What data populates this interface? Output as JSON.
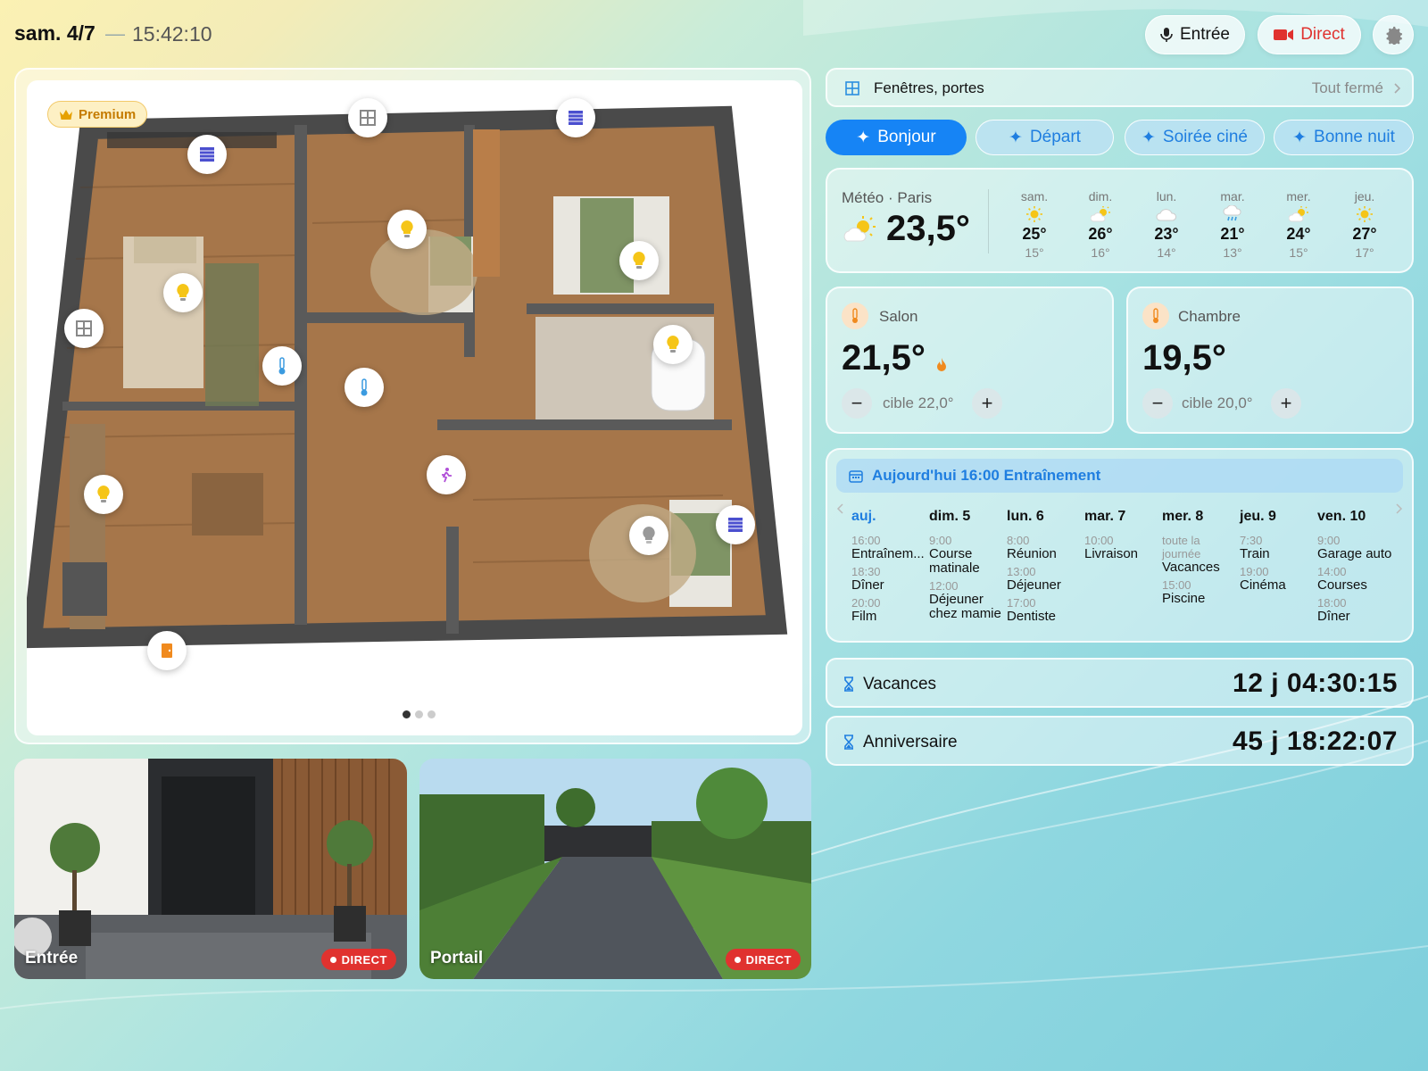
{
  "topbar": {
    "date": "sam. 4/7",
    "separator": "—",
    "time": "15:42:10",
    "entree_button": "Entrée",
    "direct_button": "Direct"
  },
  "plan": {
    "premium_badge": "Premium",
    "page_count": 3,
    "active_page": 1
  },
  "cameras": [
    {
      "label": "Entrée",
      "badge": "DIRECT"
    },
    {
      "label": "Portail",
      "badge": "DIRECT"
    }
  ],
  "windows_card": {
    "label": "Fenêtres, portes",
    "status": "Tout fermé"
  },
  "scenes": [
    {
      "label": "Bonjour",
      "active": true
    },
    {
      "label": "Départ",
      "active": false
    },
    {
      "label": "Soirée ciné",
      "active": false
    },
    {
      "label": "Bonne nuit",
      "active": false
    }
  ],
  "weather": {
    "title": "Météo · Paris",
    "current_temp": "23,5°",
    "forecast": [
      {
        "day": "sam.",
        "icon": "sun-icon",
        "high": "25°",
        "low": "15°"
      },
      {
        "day": "dim.",
        "icon": "partly-sunny-icon",
        "high": "26°",
        "low": "16°"
      },
      {
        "day": "lun.",
        "icon": "cloud-icon",
        "high": "23°",
        "low": "14°"
      },
      {
        "day": "mar.",
        "icon": "rain-icon",
        "high": "21°",
        "low": "13°"
      },
      {
        "day": "mer.",
        "icon": "partly-sunny-icon",
        "high": "24°",
        "low": "15°"
      },
      {
        "day": "jeu.",
        "icon": "sun-icon",
        "high": "27°",
        "low": "17°"
      }
    ]
  },
  "thermostats": [
    {
      "room": "Salon",
      "temp": "21,5°",
      "target": "cible 22,0°",
      "heating": true
    },
    {
      "room": "Chambre",
      "temp": "19,5°",
      "target": "cible 20,0°",
      "heating": false
    }
  ],
  "calendar": {
    "header": "Aujourd'hui 16:00 Entraînement",
    "days": [
      {
        "label": "auj.",
        "events": [
          {
            "time": "16:00",
            "name": "Entraînem..."
          },
          {
            "time": "18:30",
            "name": "Dîner"
          },
          {
            "time": "20:00",
            "name": "Film"
          }
        ]
      },
      {
        "label": "dim. 5",
        "events": [
          {
            "time": "9:00",
            "name": "Course matinale"
          },
          {
            "time": "12:00",
            "name": "Déjeuner chez mamie"
          }
        ]
      },
      {
        "label": "lun. 6",
        "events": [
          {
            "time": "8:00",
            "name": "Réunion"
          },
          {
            "time": "13:00",
            "name": "Déjeuner"
          },
          {
            "time": "17:00",
            "name": "Dentiste"
          }
        ]
      },
      {
        "label": "mar. 7",
        "events": [
          {
            "time": "10:00",
            "name": "Livraison"
          }
        ]
      },
      {
        "label": "mer. 8",
        "events": [
          {
            "time": "toute la journée",
            "name": "Vacances"
          },
          {
            "time": "15:00",
            "name": "Piscine"
          }
        ]
      },
      {
        "label": "jeu. 9",
        "events": [
          {
            "time": "7:30",
            "name": "Train"
          },
          {
            "time": "19:00",
            "name": "Cinéma"
          }
        ]
      },
      {
        "label": "ven. 10",
        "events": [
          {
            "time": "9:00",
            "name": "Garage auto"
          },
          {
            "time": "14:00",
            "name": "Courses"
          },
          {
            "time": "18:00",
            "name": "Dîner"
          }
        ]
      }
    ]
  },
  "countdowns": [
    {
      "label": "Vacances",
      "value": "12 j 04:30:15"
    },
    {
      "label": "Anniversaire",
      "value": "45 j 18:22:07"
    }
  ],
  "colors": {
    "accent": "#1684f5",
    "live_red": "#e0322f",
    "premium": "#c57b00",
    "bulb": "#f5c518"
  }
}
